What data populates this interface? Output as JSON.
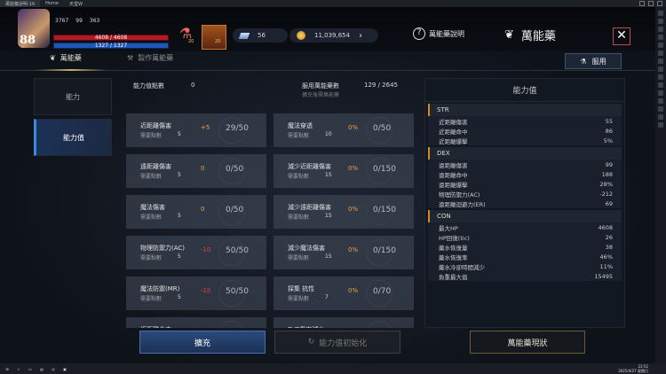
{
  "window": {
    "title": "萬能藥說明-16",
    "tabs": [
      "Home",
      "天堂W"
    ]
  },
  "player": {
    "level": "88",
    "power": "3767",
    "stat_a": "99",
    "stat_b": "363",
    "hp": "4608 / 4608",
    "mp": "1327 / 1327"
  },
  "buffs": {
    "potion_count": "20",
    "scroll_count": "20"
  },
  "currency": {
    "gems": "56",
    "gold": "11,039,654"
  },
  "header": {
    "help_label": "萬能藥說明",
    "title": "萬能藥",
    "close_label": "✕"
  },
  "tabs": {
    "main": "萬能藥",
    "secondary": "製作萬能藥",
    "use_button": "服用"
  },
  "sidebar": {
    "items": [
      {
        "label": "能力"
      },
      {
        "label": "能力值"
      }
    ]
  },
  "points": {
    "label": "能力值點數",
    "value": "0",
    "taken_label": "服用萬能藥數",
    "taken_value": "129 / 2645",
    "note": "擴充後需萬能藥"
  },
  "abilities": [
    {
      "name": "近距離傷害",
      "req_label": "需要點數",
      "req": "5",
      "bonus": "+5",
      "bonus_color": "#f0a040",
      "fill": "29/50"
    },
    {
      "name": "魔法穿透",
      "req_label": "需要點數",
      "req": "10",
      "bonus": "0%",
      "bonus_color": "#f0a040",
      "fill": "0/50"
    },
    {
      "name": "遠距離傷害",
      "req_label": "需要點數",
      "req": "5",
      "bonus": "0",
      "bonus_color": "#f0a040",
      "fill": "0/50"
    },
    {
      "name": "減少近距離傷害",
      "req_label": "需要點數",
      "req": "15",
      "bonus": "0%",
      "bonus_color": "#f0a040",
      "fill": "0/150"
    },
    {
      "name": "魔法傷害",
      "req_label": "需要點數",
      "req": "5",
      "bonus": "0",
      "bonus_color": "#f0a040",
      "fill": "0/50"
    },
    {
      "name": "減少遠距離傷害",
      "req_label": "需要點數",
      "req": "15",
      "bonus": "0%",
      "bonus_color": "#f0a040",
      "fill": "0/150"
    },
    {
      "name": "物理防禦力(AC)",
      "req_label": "需要點數",
      "req": "5",
      "bonus": "-10",
      "bonus_color": "#e04040",
      "fill": "50/50"
    },
    {
      "name": "減少魔法傷害",
      "req_label": "需要點數",
      "req": "15",
      "bonus": "0%",
      "bonus_color": "#f0a040",
      "fill": "0/150"
    },
    {
      "name": "魔法防禦(MR)",
      "req_label": "需要點數",
      "req": "5",
      "bonus": "-10",
      "bonus_color": "#e04040",
      "fill": "50/50"
    },
    {
      "name": "採集 抗性",
      "req_label": "需要點數",
      "req": "7",
      "bonus": "0%",
      "bonus_color": "#f0a040",
      "fill": "0/70"
    },
    {
      "name": "近距離命中",
      "req_label": "需要點數",
      "req": "5",
      "bonus": "0",
      "bonus_color": "#f0a040",
      "fill": "0/50"
    },
    {
      "name": "PVP傷害減少",
      "req_label": "需要點數",
      "req": "20",
      "bonus": "0%",
      "bonus_color": "#f0a040",
      "fill": "0/200"
    }
  ],
  "stat_panel": {
    "title": "能力值",
    "sections": [
      {
        "name": "STR",
        "rows": [
          {
            "k": "近距離傷害",
            "v": "55"
          },
          {
            "k": "近距離命中",
            "v": "86"
          },
          {
            "k": "近距離爆擊",
            "v": "5%"
          }
        ]
      },
      {
        "name": "DEX",
        "rows": [
          {
            "k": "遠距離傷害",
            "v": "99"
          },
          {
            "k": "遠距離命中",
            "v": "188"
          },
          {
            "k": "遠距離爆擊",
            "v": "28%"
          },
          {
            "k": "物理防禦力(AC)",
            "v": "-212"
          },
          {
            "k": "遠距離迴避力(ER)",
            "v": "69"
          }
        ]
      },
      {
        "name": "CON",
        "rows": [
          {
            "k": "最大HP",
            "v": "4608"
          },
          {
            "k": "HP回復(tic)",
            "v": "26"
          },
          {
            "k": "藥水恢復量",
            "v": "38"
          },
          {
            "k": "藥水恢復率",
            "v": "46%"
          },
          {
            "k": "藥水冷卻時間減少",
            "v": "11%"
          },
          {
            "k": "負重最大值",
            "v": "15495"
          }
        ]
      }
    ]
  },
  "footer": {
    "expand": "擴充",
    "reset": "能力值初始化",
    "status": "萬能藥現狀"
  },
  "taskbar": {
    "time": "23:52",
    "date": "2025/4/27 星期日"
  }
}
